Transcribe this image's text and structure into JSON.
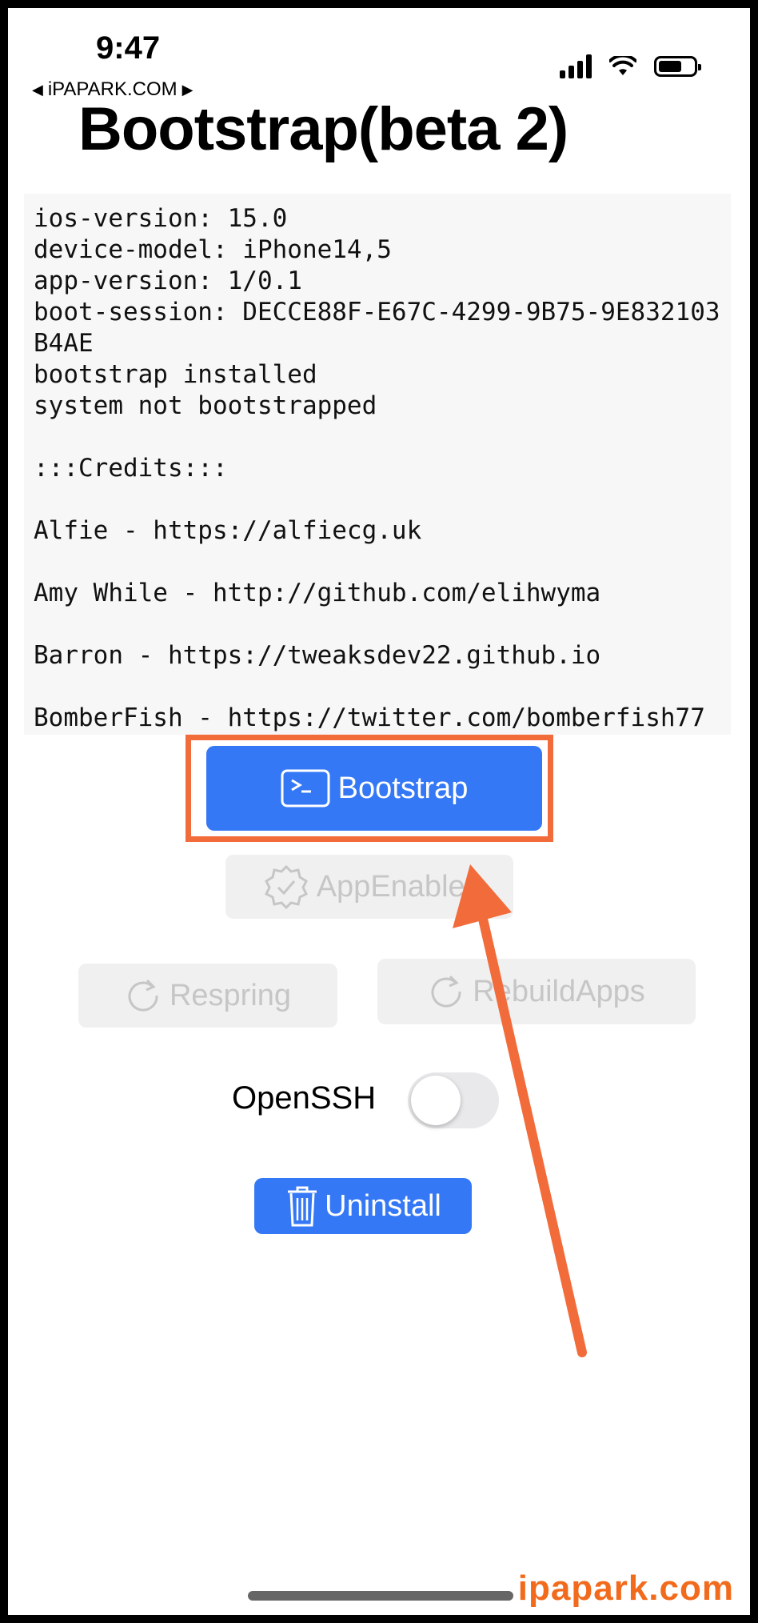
{
  "status_bar": {
    "time": "9:47",
    "back_link": "iPAPARK.COM"
  },
  "title": "Bootstrap(beta 2)",
  "log_text": "ios-version: 15.0\ndevice-model: iPhone14,5\napp-version: 1/0.1\nboot-session: DECCE88F-E67C-4299-9B75-9E832103B4AE\nbootstrap installed\nsystem not bootstrapped\n\n:::Credits:::\n\nAlfie - https://alfiecg.uk\n\nAmy While - http://github.com/elihwyma\n\nBarron - https://tweaksdev22.github.io\n\nBomberFish - https://twitter.com/bomberfish77",
  "buttons": {
    "bootstrap": "Bootstrap",
    "app_enabler": "AppEnabler",
    "respring": "Respring",
    "rebuild_apps": "RebuildApps",
    "uninstall": "Uninstall"
  },
  "openssh": {
    "label": "OpenSSH",
    "enabled": false
  },
  "watermark": "ipapark.com",
  "colors": {
    "primary": "#3578f6",
    "highlight": "#f26b3a",
    "watermark": "#f26b1d"
  }
}
